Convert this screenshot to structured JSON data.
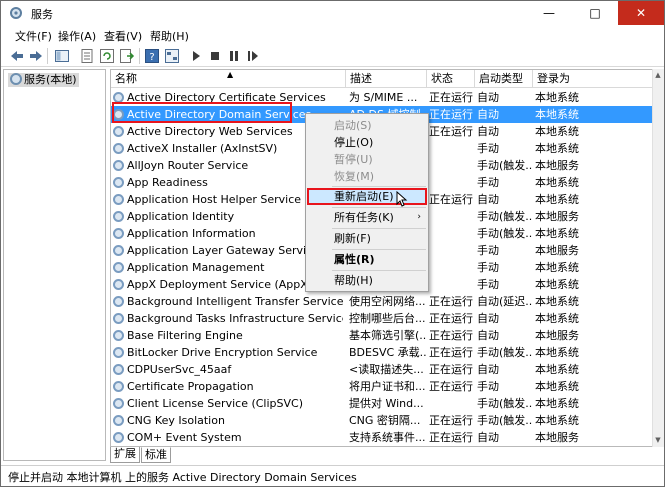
{
  "window": {
    "title": "服务",
    "controls": {
      "minimize": "—",
      "maximize": "□",
      "close": "✕"
    }
  },
  "menubar": {
    "items": [
      "文件(F)",
      "操作(A)",
      "查看(V)",
      "帮助(H)"
    ]
  },
  "tree": {
    "root_label": "服务(本地)"
  },
  "table": {
    "columns": [
      "名称",
      "描述",
      "状态",
      "启动类型",
      "登录为"
    ],
    "rows": [
      {
        "name": "Active Directory Certificate Services",
        "desc": "为 S/MIME ...",
        "status": "正在运行",
        "start": "自动",
        "logon": "本地系统"
      },
      {
        "name": "Active Directory Domain Services",
        "desc": "AD DS 域控制...",
        "status": "正在运行",
        "start": "自动",
        "logon": "本地系统"
      },
      {
        "name": "Active Directory Web Services",
        "desc": "",
        "status": "正在运行",
        "start": "自动",
        "logon": "本地系统"
      },
      {
        "name": "ActiveX Installer (AxInstSV)",
        "desc": "",
        "status": "",
        "start": "手动",
        "logon": "本地系统"
      },
      {
        "name": "AllJoyn Router Service",
        "desc": "",
        "status": "",
        "start": "手动(触发...",
        "logon": "本地服务"
      },
      {
        "name": "App Readiness",
        "desc": "",
        "status": "",
        "start": "手动",
        "logon": "本地系统"
      },
      {
        "name": "Application Host Helper Service",
        "desc": "",
        "status": "正在运行",
        "start": "自动",
        "logon": "本地系统"
      },
      {
        "name": "Application Identity",
        "desc": "",
        "status": "",
        "start": "手动(触发...",
        "logon": "本地服务"
      },
      {
        "name": "Application Information",
        "desc": "",
        "status": "",
        "start": "手动(触发...",
        "logon": "本地系统"
      },
      {
        "name": "Application Layer Gateway Service",
        "desc": "",
        "status": "",
        "start": "手动",
        "logon": "本地服务"
      },
      {
        "name": "Application Management",
        "desc": "",
        "status": "",
        "start": "手动",
        "logon": "本地系统"
      },
      {
        "name": "AppX Deployment Service (AppXSVC)",
        "desc": "",
        "status": "",
        "start": "手动",
        "logon": "本地系统"
      },
      {
        "name": "Background Intelligent Transfer Service",
        "desc": "使用空闲网络...",
        "status": "正在运行",
        "start": "自动(延迟...",
        "logon": "本地系统"
      },
      {
        "name": "Background Tasks Infrastructure Service",
        "desc": "控制哪些后台...",
        "status": "正在运行",
        "start": "自动",
        "logon": "本地系统"
      },
      {
        "name": "Base Filtering Engine",
        "desc": "基本筛选引擎(...",
        "status": "正在运行",
        "start": "自动",
        "logon": "本地服务"
      },
      {
        "name": "BitLocker Drive Encryption Service",
        "desc": "BDESVC 承载...",
        "status": "正在运行",
        "start": "手动(触发...",
        "logon": "本地系统"
      },
      {
        "name": "CDPUserSvc_45aaf",
        "desc": "<读取描述失...",
        "status": "正在运行",
        "start": "自动",
        "logon": "本地系统"
      },
      {
        "name": "Certificate Propagation",
        "desc": "将用户证书和...",
        "status": "正在运行",
        "start": "手动",
        "logon": "本地系统"
      },
      {
        "name": "Client License Service (ClipSVC)",
        "desc": "提供对 Wind...",
        "status": "",
        "start": "手动(触发...",
        "logon": "本地系统"
      },
      {
        "name": "CNG Key Isolation",
        "desc": "CNG 密钥隔...",
        "status": "正在运行",
        "start": "手动(触发...",
        "logon": "本地系统"
      },
      {
        "name": "COM+ Event System",
        "desc": "支持系统事件...",
        "status": "正在运行",
        "start": "自动",
        "logon": "本地服务"
      }
    ],
    "selected_index": 1
  },
  "context_menu": {
    "items": [
      {
        "label": "启动(S)",
        "disabled": true
      },
      {
        "label": "停止(O)",
        "disabled": false
      },
      {
        "label": "暂停(U)",
        "disabled": true
      },
      {
        "label": "恢复(M)",
        "disabled": true
      },
      {
        "label": "重新启动(E)",
        "disabled": false,
        "active": true
      },
      {
        "label": "所有任务(K)",
        "disabled": false,
        "submenu": true
      },
      {
        "label": "刷新(F)",
        "disabled": false
      },
      {
        "label": "属性(R)",
        "disabled": false,
        "bold": true
      },
      {
        "label": "帮助(H)",
        "disabled": false
      }
    ],
    "submenu_arrow": "›"
  },
  "tabs": [
    "扩展",
    "标准"
  ],
  "statusbar": {
    "text": "停止并启动 本地计算机 上的服务 Active Directory Domain Services"
  },
  "colors": {
    "selection": "#3399ff",
    "highlight_border": "#e8141c",
    "close_button": "#c42b1c"
  }
}
